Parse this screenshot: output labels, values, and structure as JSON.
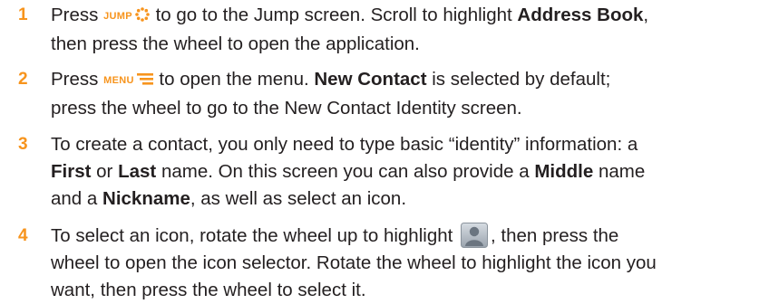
{
  "steps": [
    {
      "number": "1",
      "key_label": "JUMP",
      "key_icon": "jump-icon",
      "line1_pre": "Press",
      "line1_mid": "to go to the Jump screen. Scroll to highlight",
      "line1_bold": "Address Book",
      "line1_end": ",",
      "line2": "then press the wheel to open the application."
    },
    {
      "number": "2",
      "key_label": "MENU",
      "key_icon": "menu-icon",
      "line1_pre": "Press",
      "line1_mid": "to open the menu.",
      "line1_bold": "New Contact",
      "line1_end": "is selected by default;",
      "line2": "press the wheel to go to the New Contact Identity screen."
    },
    {
      "number": "3",
      "line1": "To create a contact, you only need to type basic “identity” information: a",
      "line2_bold1": "First",
      "line2_mid": "or",
      "line2_bold2": "Last",
      "line2_end": "name. On this screen you can also provide a",
      "line2_bold3": "Middle",
      "line2_tail": "name",
      "line3_pre": "and a",
      "line3_bold": "Nickname",
      "line3_end": ", as well as select an icon."
    },
    {
      "number": "4",
      "line1_pre": "To select an icon, rotate the wheel up to highlight",
      "line1_icon": "contact-avatar-icon",
      "line1_end": ", then press the",
      "line2": "wheel to open the icon selector. Rotate the wheel to highlight the icon you",
      "line3": "want, then press the wheel to select it."
    }
  ],
  "colors": {
    "accent": "#f7941d",
    "text": "#231f20"
  }
}
